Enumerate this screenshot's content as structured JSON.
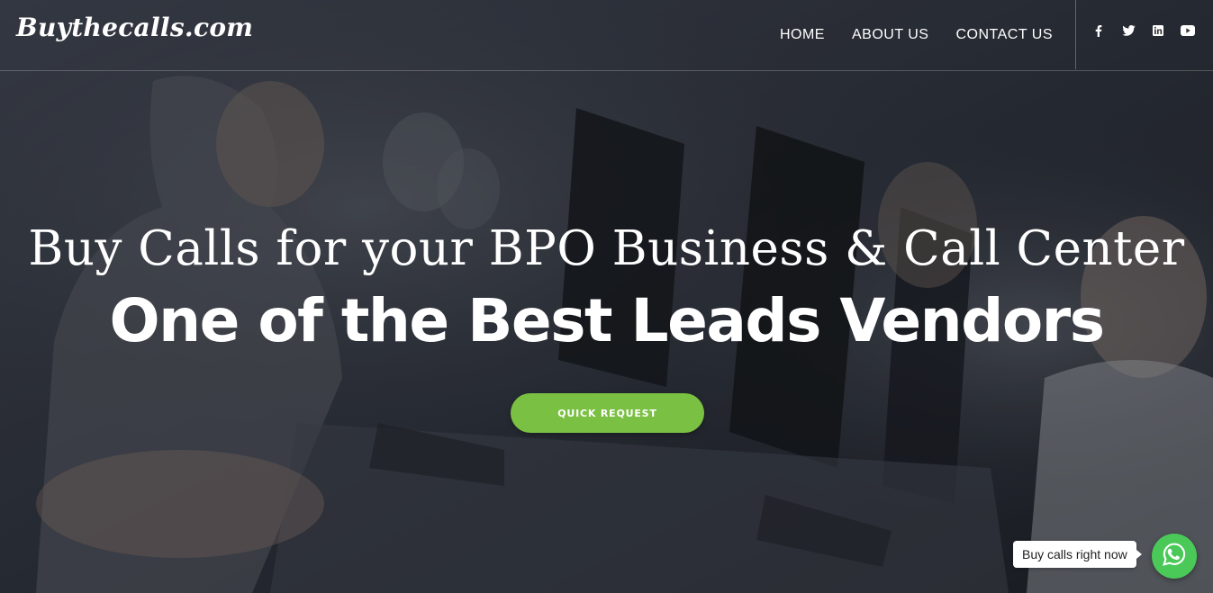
{
  "brand": {
    "logo_text": "Buythecalls.com"
  },
  "nav": {
    "items": [
      {
        "label": "HOME"
      },
      {
        "label": "ABOUT US"
      },
      {
        "label": "CONTACT US"
      }
    ]
  },
  "social": {
    "icons": [
      "facebook-icon",
      "twitter-icon",
      "linkedin-icon",
      "youtube-icon"
    ]
  },
  "hero": {
    "subtitle": "Buy Calls for your BPO Business & Call Center",
    "title": "One of the Best Leads Vendors",
    "cta_label": "QUICK REQUEST"
  },
  "whatsapp": {
    "tooltip": "Buy calls right now",
    "icon": "whatsapp-icon"
  },
  "colors": {
    "accent_green": "#7ac043",
    "whatsapp_green": "#4ac959",
    "text_white": "#ffffff"
  }
}
